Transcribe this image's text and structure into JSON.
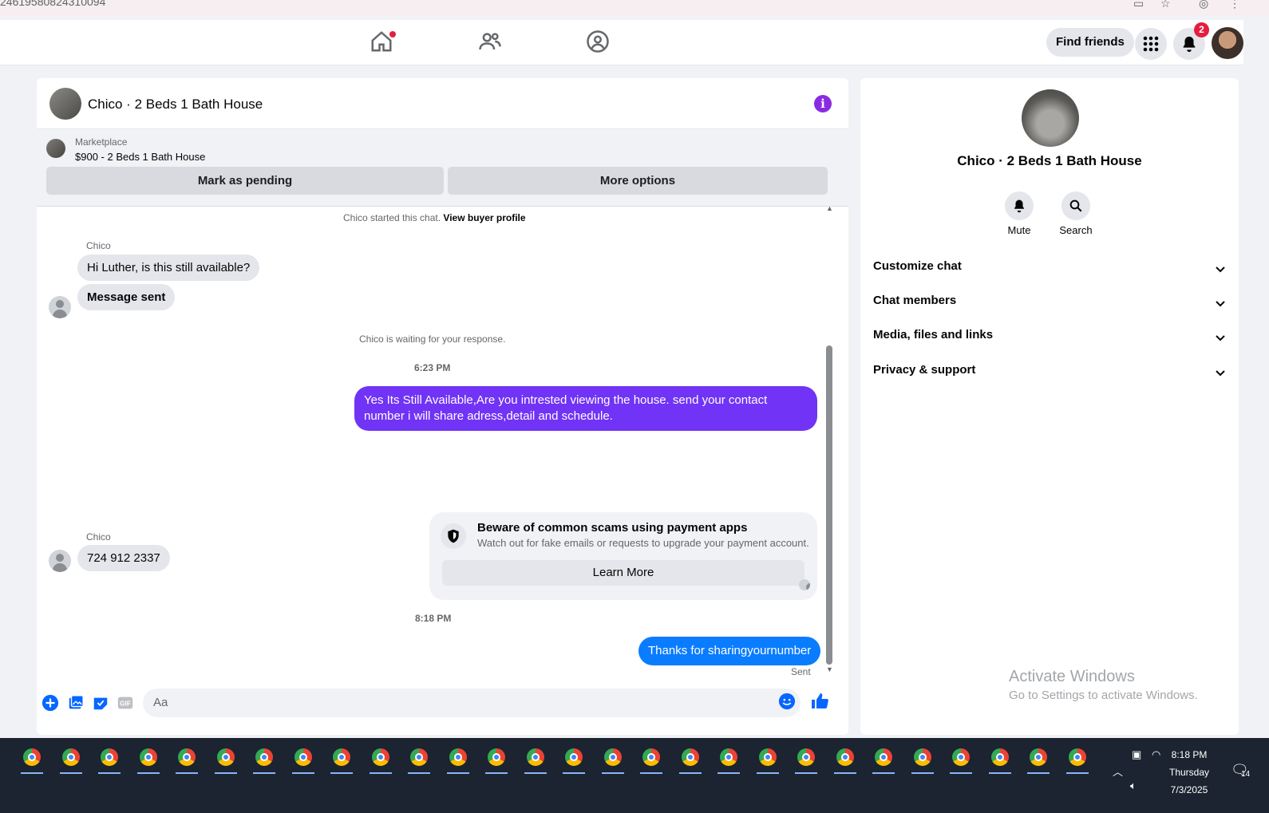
{
  "browser": {
    "url_fragment": "24619580824310094"
  },
  "topnav": {
    "find_friends_label": "Find friends",
    "notification_count": "2"
  },
  "chat": {
    "title": "Chico · 2 Beds 1 Bath House",
    "marketplace": {
      "label": "Marketplace",
      "listing": "$900 - 2 Beds 1 Bath House",
      "mark_pending_label": "Mark as pending",
      "more_options_label": "More options"
    },
    "started_text": "Chico started this chat.",
    "view_buyer_profile_label": "View buyer profile",
    "sender_name": "Chico",
    "msg1": "Hi Luther, is this still available?",
    "msg2": "Message sent",
    "waiting_text": "Chico is waiting for your response.",
    "time1": "6:23 PM",
    "reply1": "Yes Its Still Available,Are you intrested viewing the house. send your contact number i will share adress,detail and schedule.",
    "scam_title": "Beware of common scams using payment apps",
    "scam_body": "Watch out for fake emails or requests to upgrade your payment account.",
    "learn_more_label": "Learn More",
    "sender_name2": "Chico",
    "msg3": "724 912 2337",
    "time2": "8:18 PM",
    "reply2": "Thanks for sharingyournumber",
    "sent_status": "Sent",
    "composer_placeholder": "Aa",
    "colors": {
      "outgoing_purple": "#7133f5",
      "outgoing_blue": "#0a7cff",
      "accent": "#0866ff"
    }
  },
  "right_panel": {
    "title": "Chico · 2 Beds 1 Bath House",
    "mute_label": "Mute",
    "search_label": "Search",
    "sections": [
      "Customize chat",
      "Chat members",
      "Media, files and links",
      "Privacy & support"
    ],
    "activate_title": "Activate Windows",
    "activate_sub": "Go to Settings to activate Windows."
  },
  "taskbar": {
    "time": "8:18 PM",
    "day": "Thursday",
    "date": "7/3/2025",
    "notif_count": "14"
  }
}
